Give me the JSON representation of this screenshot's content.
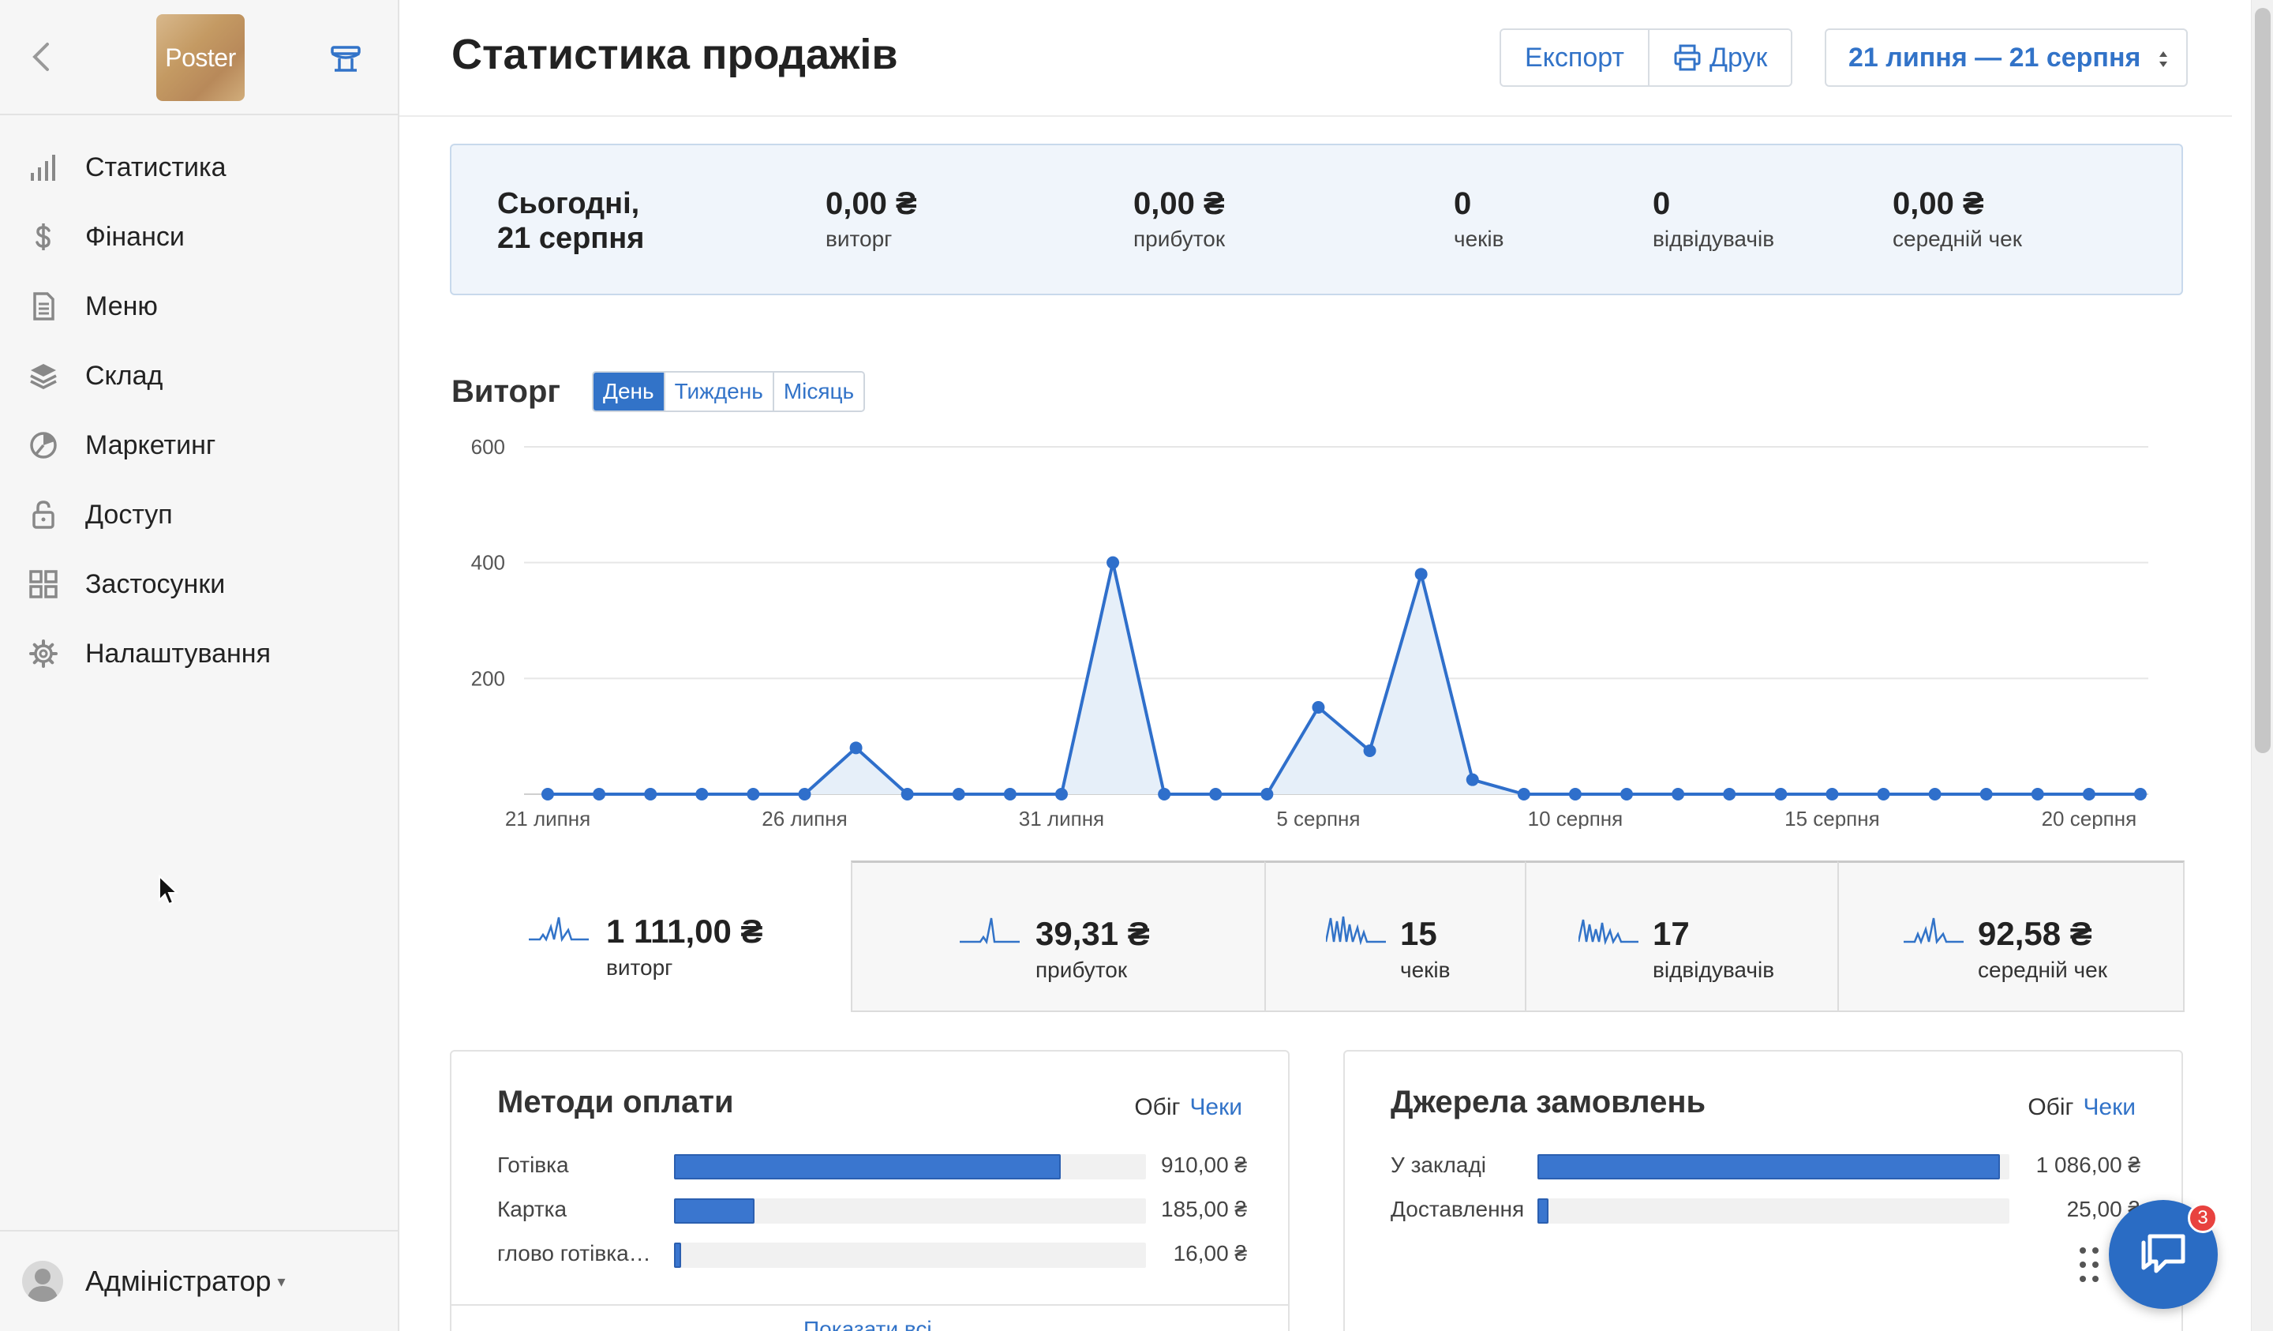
{
  "sidebar": {
    "logo": "Poster",
    "items": [
      {
        "label": "Статистика",
        "icon": "bar-chart-icon"
      },
      {
        "label": "Фінанси",
        "icon": "dollar-icon"
      },
      {
        "label": "Меню",
        "icon": "document-icon"
      },
      {
        "label": "Склад",
        "icon": "layers-icon"
      },
      {
        "label": "Маркетинг",
        "icon": "pie-chart-icon"
      },
      {
        "label": "Доступ",
        "icon": "lock-icon"
      },
      {
        "label": "Застосунки",
        "icon": "grid-icon"
      },
      {
        "label": "Налаштування",
        "icon": "gear-icon"
      }
    ],
    "user": "Адміністратор"
  },
  "header": {
    "title": "Статистика продажів",
    "export_label": "Експорт",
    "print_label": "Друк",
    "date_range": "21 липня — 21 серпня"
  },
  "today": {
    "title_line1": "Сьогодні,",
    "title_line2": "21 серпня",
    "stats": [
      {
        "value": "0,00 ₴",
        "label": "виторг"
      },
      {
        "value": "0,00 ₴",
        "label": "прибуток"
      },
      {
        "value": "0",
        "label": "чеків"
      },
      {
        "value": "0",
        "label": "відвідувачів"
      },
      {
        "value": "0,00 ₴",
        "label": "середній чек"
      }
    ]
  },
  "revenue": {
    "title": "Виторг",
    "periods": [
      "День",
      "Тиждень",
      "Місяць"
    ],
    "active_period": "День"
  },
  "chart_data": {
    "type": "area",
    "title": "Виторг",
    "x_tick_labels": [
      "21 липня",
      "26 липня",
      "31 липня",
      "5 серпня",
      "10 серпня",
      "15 серпня",
      "20 серпня"
    ],
    "x": [
      "21 липня",
      "22 липня",
      "23 липня",
      "24 липня",
      "25 липня",
      "26 липня",
      "27 липня",
      "28 липня",
      "29 липня",
      "30 липня",
      "31 липня",
      "1 серпня",
      "2 серпня",
      "3 серпня",
      "4 серпня",
      "5 серпня",
      "6 серпня",
      "7 серпня",
      "8 серпня",
      "9 серпня",
      "10 серпня",
      "11 серпня",
      "12 серпня",
      "13 серпня",
      "14 серпня",
      "15 серпня",
      "16 серпня",
      "17 серпня",
      "18 серпня",
      "19 серпня",
      "20 серпня",
      "21 серпня"
    ],
    "values": [
      0,
      0,
      0,
      0,
      0,
      0,
      80,
      0,
      0,
      0,
      0,
      400,
      0,
      0,
      0,
      150,
      75,
      380,
      25,
      0,
      0,
      0,
      0,
      0,
      0,
      0,
      0,
      0,
      0,
      0,
      0,
      0
    ],
    "y_ticks": [
      200,
      400,
      600
    ],
    "ylim": [
      0,
      600
    ],
    "grid": true,
    "color": "#2f6fcb"
  },
  "totals": [
    {
      "value": "1 111,00 ₴",
      "label": "виторг"
    },
    {
      "value": "39,31 ₴",
      "label": "прибуток"
    },
    {
      "value": "15",
      "label": "чеків"
    },
    {
      "value": "17",
      "label": "відвідувачів"
    },
    {
      "value": "92,58 ₴",
      "label": "середній чек"
    }
  ],
  "payment_methods": {
    "title": "Методи оплати",
    "toggle_a": "Обіг",
    "toggle_b": "Чеки",
    "rows": [
      {
        "name": "Готівка",
        "amount": "910,00 ₴",
        "fraction": 0.82
      },
      {
        "name": "Картка",
        "amount": "185,00 ₴",
        "fraction": 0.17
      },
      {
        "name": "глово готівка…",
        "amount": "16,00 ₴",
        "fraction": 0.015
      }
    ],
    "show_all": "Показати всі"
  },
  "order_sources": {
    "title": "Джерела замовлень",
    "toggle_a": "Обіг",
    "toggle_b": "Чеки",
    "rows": [
      {
        "name": "У закладі",
        "amount": "1 086,00 ₴",
        "fraction": 0.98
      },
      {
        "name": "Доставлення",
        "amount": "25,00 ₴",
        "fraction": 0.023
      }
    ]
  },
  "chat": {
    "badge": "3"
  }
}
